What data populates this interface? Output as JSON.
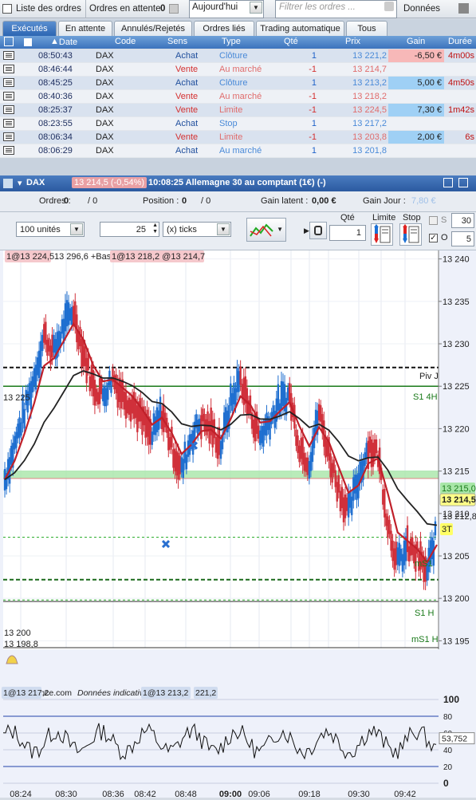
{
  "topbar": {
    "orders_list": "Liste des ordres",
    "pending_orders": "Ordres en attente",
    "pending_count": "0",
    "date_filter": "Aujourd'hui",
    "filter_placeholder": "Filtrer les ordres ...",
    "data_label": "Données"
  },
  "tabs": [
    "Exécutés",
    "En attente",
    "Annulés/Rejetés",
    "Ordres liés",
    "Trading automatique",
    "Tous"
  ],
  "columns": {
    "date": "Date",
    "code": "Code",
    "sens": "Sens",
    "type": "Type",
    "qte": "Qté",
    "prix": "Prix",
    "gain": "Gain",
    "duree": "Durée"
  },
  "orders": [
    {
      "date": "08:50:43",
      "code": "DAX",
      "sens": "Achat",
      "type": "Clôture",
      "qte": "1",
      "prix": "13 221,2",
      "gain": "-6,50 €",
      "duree": "4m00s",
      "side": "buy"
    },
    {
      "date": "08:46:44",
      "code": "DAX",
      "sens": "Vente",
      "type": "Au marché",
      "qte": "-1",
      "prix": "13 214,7",
      "gain": "",
      "duree": "",
      "side": "sell"
    },
    {
      "date": "08:45:25",
      "code": "DAX",
      "sens": "Achat",
      "type": "Clôture",
      "qte": "1",
      "prix": "13 213,2",
      "gain": "5,00 €",
      "duree": "4m50s",
      "side": "buy"
    },
    {
      "date": "08:40:36",
      "code": "DAX",
      "sens": "Vente",
      "type": "Au marché",
      "qte": "-1",
      "prix": "13 218,2",
      "gain": "",
      "duree": "",
      "side": "sell"
    },
    {
      "date": "08:25:37",
      "code": "DAX",
      "sens": "Vente",
      "type": "Limite",
      "qte": "-1",
      "prix": "13 224,5",
      "gain": "7,30 €",
      "duree": "1m42s",
      "side": "sell"
    },
    {
      "date": "08:23:55",
      "code": "DAX",
      "sens": "Achat",
      "type": "Stop",
      "qte": "1",
      "prix": "13 217,2",
      "gain": "",
      "duree": "",
      "side": "buy"
    },
    {
      "date": "08:06:34",
      "code": "DAX",
      "sens": "Vente",
      "type": "Limite",
      "qte": "-1",
      "prix": "13 203,8",
      "gain": "2,00 €",
      "duree": "6s",
      "side": "sell"
    },
    {
      "date": "08:06:29",
      "code": "DAX",
      "sens": "Achat",
      "type": "Au marché",
      "qte": "1",
      "prix": "13 201,8",
      "gain": "",
      "duree": "",
      "side": "buy"
    }
  ],
  "chart_header": {
    "symbol": "DAX",
    "price_badge": "13 214,5 (-0,54%)",
    "title": "10:08:25 Allemagne 30 au comptant (1€) (-)"
  },
  "infobar": {
    "orders_label": "Ordres :",
    "orders_val": "0",
    "orders_val2": "/ 0",
    "position_label": "Position :",
    "position_val": "0",
    "position_val2": "/ 0",
    "gain_latent_label": "Gain latent :",
    "gain_latent_val": "0,00 €",
    "gain_jour_label": "Gain Jour :",
    "gain_jour_val": "7,80 €"
  },
  "toolbar": {
    "units": "100 unités",
    "ticks_value": "25",
    "ticks_unit": "(x) ticks",
    "qty_label": "Qté",
    "qty_value": "1",
    "limit_label": "Limite",
    "stop_label": "Stop",
    "s_label": "S",
    "s_value": "30",
    "o_label": "O",
    "o_value": "5"
  },
  "chart_overlay": {
    "top_left": "1@13 224,5",
    "mid_top": "13 296,6 +Bas",
    "right_badge": "1@13 218,2 @13 214,7",
    "level_13225": "13 225",
    "level_13200": "13 200",
    "level_131988": "13 198,8",
    "piv": "Piv J",
    "s1_4h": "S1 4H",
    "ms1": "mS1",
    "s1_h": "S1 H",
    "ms1_h": "mS1 H",
    "price_tag": "13 214,5",
    "price_tag2": "13 215,0",
    "price_tag3": "13 212,8",
    "tag_3t": "3T",
    "footer_left": "© IT-Finance.com",
    "footer_data": "Données indicatives",
    "footer_badge": "1@13 213,2",
    "footer_badge2": "221,2",
    "footer_first": "1@13 217,2"
  },
  "chart_data": {
    "type": "line",
    "title": "Allemagne 30 au comptant (1€)",
    "y_ticks": [
      "13 240",
      "13 235",
      "13 230",
      "13 225",
      "13 220",
      "13 215",
      "13 210",
      "13 205",
      "13 200",
      "13 195"
    ],
    "ylim": [
      13194,
      13241
    ],
    "x_ticks": [
      "08:24",
      "08:30",
      "08:36",
      "08:42",
      "08:48",
      "09:00",
      "09:06",
      "09:12",
      "09:18",
      "09:24",
      "09:30",
      "09:36",
      "09:42"
    ],
    "series": [
      {
        "values": [
          13214,
          13218,
          13222,
          13226,
          13231,
          13229,
          13232,
          13234,
          13229,
          13225,
          13224,
          13226,
          13224,
          13223,
          13221,
          13219,
          13222,
          13218,
          13215,
          13219,
          13221,
          13220,
          13218,
          13223,
          13226,
          13222,
          13219,
          13221,
          13223,
          13224,
          13218,
          13216,
          13222,
          13217,
          13213,
          13210,
          13214,
          13218,
          13217,
          13209,
          13204,
          13206,
          13205,
          13203,
          13208
        ]
      }
    ],
    "key_levels": {
      "piv_j": 13227.2,
      "s1_4h": 13225,
      "green_band": 13214.5,
      "ms1": 13207.2,
      "s1_h": 13202.2,
      "ms1_h": 13199.8
    },
    "oscillator": {
      "y_ticks": [
        "100",
        "80",
        "60",
        "40",
        "20",
        "0"
      ],
      "ylim": [
        0,
        100
      ],
      "current": "53,752"
    }
  }
}
